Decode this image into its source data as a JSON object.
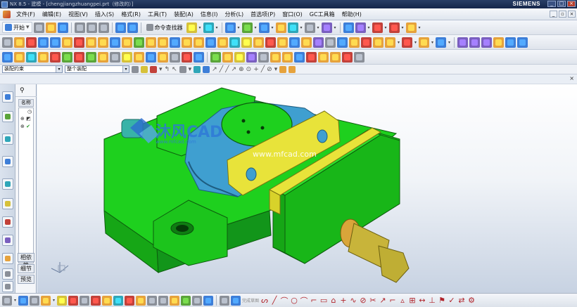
{
  "window": {
    "title": "NX 8.5 - 建模 - [chengjiangzhuangpei.prt（修改的）]",
    "brand": "SIEMENS",
    "controls": [
      "_",
      "□",
      "×"
    ]
  },
  "menubar": {
    "items": [
      "文件(F)",
      "编辑(E)",
      "视图(V)",
      "插入(S)",
      "格式(R)",
      "工具(T)",
      "装配(A)",
      "信息(I)",
      "分析(L)",
      "首选项(P)",
      "窗口(O)",
      "GC工具箱",
      "帮助(H)"
    ]
  },
  "toolbar1": {
    "start_label": "开始",
    "command_finder_label": "命令查找器"
  },
  "selection_bar": {
    "filter_value": "装配约束",
    "scope_value": "整个装配"
  },
  "nav_panel": {
    "column_header": "名称",
    "buttons": [
      "相依性",
      "细节",
      "预览"
    ]
  },
  "watermark": {
    "logo_text": "沐风CAD",
    "logo_url": "www.mfcad.com",
    "center_url": "www.mfcad.com"
  },
  "bottombar": {
    "sketch_label": "完成草图"
  },
  "colors": {
    "body_green": "#1ed01e",
    "clamp_blue": "#3f9fd0",
    "jaw_yellow": "#e8e33a",
    "screw_gold": "#c8b43a"
  }
}
